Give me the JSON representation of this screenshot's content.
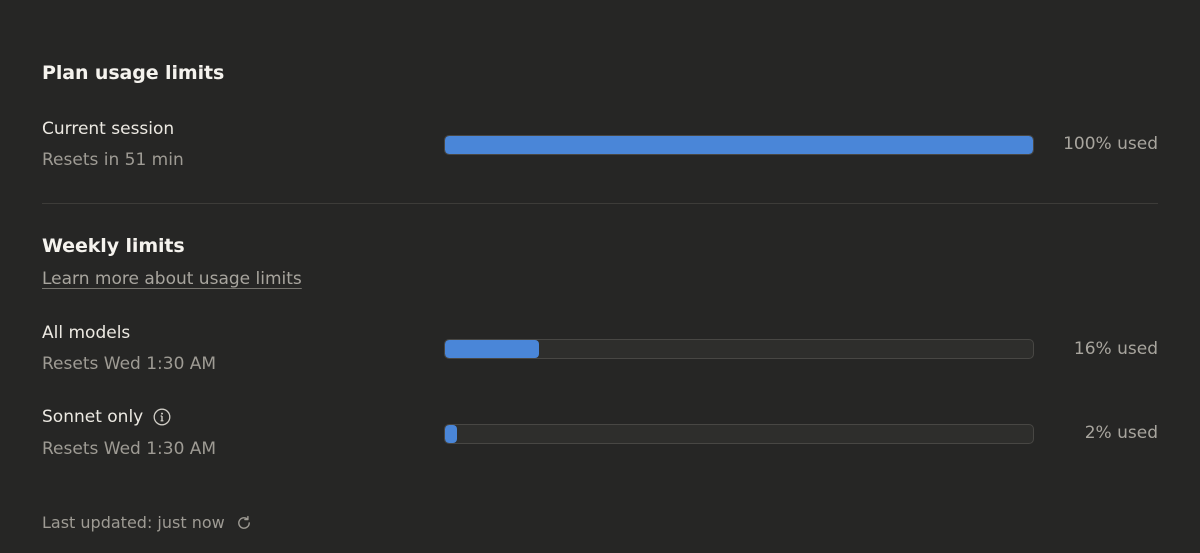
{
  "plan": {
    "title": "Plan usage limits",
    "current_session": {
      "label": "Current session",
      "reset": "Resets in 51 min",
      "used_fraction": 1.0,
      "used_text": "100% used"
    }
  },
  "weekly": {
    "title": "Weekly limits",
    "learn_more": "Learn more about usage limits",
    "all_models": {
      "label": "All models",
      "reset": "Resets Wed 1:30 AM",
      "used_fraction": 0.16,
      "used_text": "16% used"
    },
    "sonnet": {
      "label": "Sonnet only",
      "reset": "Resets Wed 1:30 AM",
      "used_fraction": 0.02,
      "used_text": "2% used"
    }
  },
  "footer": {
    "last_updated": "Last updated: just now"
  },
  "icons": {
    "info": "info-icon",
    "refresh": "refresh-icon"
  },
  "colors": {
    "background": "#262625",
    "bar_fill": "#4a86d8",
    "bar_track": "#2e2e2c"
  }
}
